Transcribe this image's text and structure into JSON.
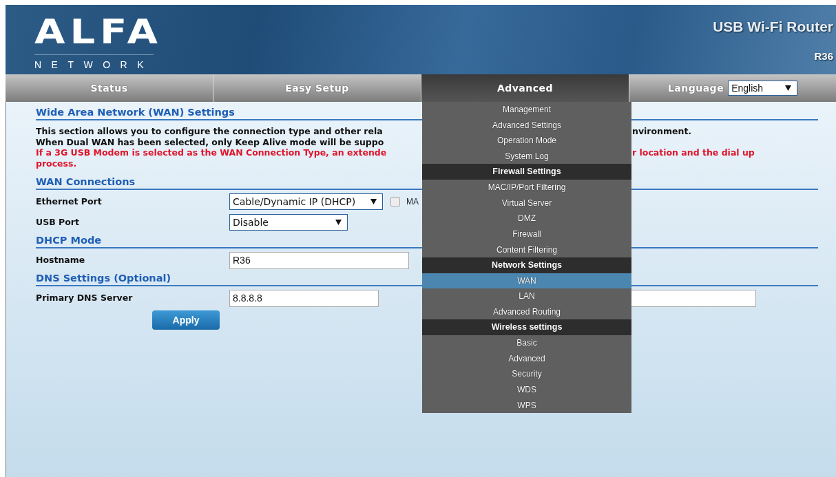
{
  "header": {
    "logo": "ALFA",
    "logo_sub": "NETWORK",
    "product": "USB Wi-Fi Router",
    "model": "R36"
  },
  "nav": {
    "tabs": [
      {
        "label": "Status",
        "selected": false
      },
      {
        "label": "Easy Setup",
        "selected": false
      },
      {
        "label": "Advanced",
        "selected": true
      }
    ],
    "language": {
      "label": "Language",
      "value": "English"
    }
  },
  "menu": {
    "items": [
      {
        "kind": "item",
        "label": "Management",
        "selected": false
      },
      {
        "kind": "item",
        "label": "Advanced Settings",
        "selected": false
      },
      {
        "kind": "item",
        "label": "Operation Mode",
        "selected": false
      },
      {
        "kind": "item",
        "label": "System Log",
        "selected": false
      },
      {
        "kind": "header",
        "label": "Firewall Settings",
        "selected": false
      },
      {
        "kind": "item",
        "label": "MAC/IP/Port Filtering",
        "selected": false
      },
      {
        "kind": "item",
        "label": "Virtual Server",
        "selected": false
      },
      {
        "kind": "item",
        "label": "DMZ",
        "selected": false
      },
      {
        "kind": "item",
        "label": "Firewall",
        "selected": false
      },
      {
        "kind": "item",
        "label": "Content Filtering",
        "selected": false
      },
      {
        "kind": "header",
        "label": "Network Settings",
        "selected": false
      },
      {
        "kind": "item",
        "label": "WAN",
        "selected": true
      },
      {
        "kind": "item",
        "label": "LAN",
        "selected": false
      },
      {
        "kind": "item",
        "label": "Advanced Routing",
        "selected": false
      },
      {
        "kind": "header",
        "label": "Wireless settings",
        "selected": false
      },
      {
        "kind": "item",
        "label": "Basic",
        "selected": false
      },
      {
        "kind": "item",
        "label": "Advanced",
        "selected": false
      },
      {
        "kind": "item",
        "label": "Security",
        "selected": false
      },
      {
        "kind": "item",
        "label": "WDS",
        "selected": false
      },
      {
        "kind": "item",
        "label": "WPS",
        "selected": false
      }
    ]
  },
  "page": {
    "title": "Wide Area Network (WAN) Settings",
    "description": [
      {
        "kind": "normal",
        "left": "This section allows you to configure the connection type and other rela",
        "right": "nvironment."
      },
      {
        "kind": "normal",
        "left": "When Dual WAN has been selected, only Keep Alive mode will be suppo"
      },
      {
        "kind": "warning",
        "left": "If a 3G USB Modem is selected as the WAN Connection Type, an extende",
        "right": "r location and the dial up"
      },
      {
        "kind": "warning",
        "left": "process."
      }
    ],
    "sections": [
      {
        "title": "WAN Connections",
        "rows": [
          {
            "label": "Ethernet Port",
            "kind": "select",
            "value": "Cable/Dynamic IP (DHCP)",
            "checkbox": {
              "checked": false,
              "label": "MA"
            }
          },
          {
            "label": "USB Port",
            "kind": "select",
            "value": "Disable"
          }
        ]
      },
      {
        "title": "DHCP Mode",
        "rows": [
          {
            "label": "Hostname",
            "kind": "text",
            "value": "R36"
          }
        ]
      },
      {
        "title": "DNS Settings (Optional)",
        "rows": [
          {
            "label": "Primary DNS Server",
            "kind": "text",
            "value": "8.8.8.8",
            "partial_field": true
          }
        ]
      }
    ],
    "apply": "Apply"
  }
}
